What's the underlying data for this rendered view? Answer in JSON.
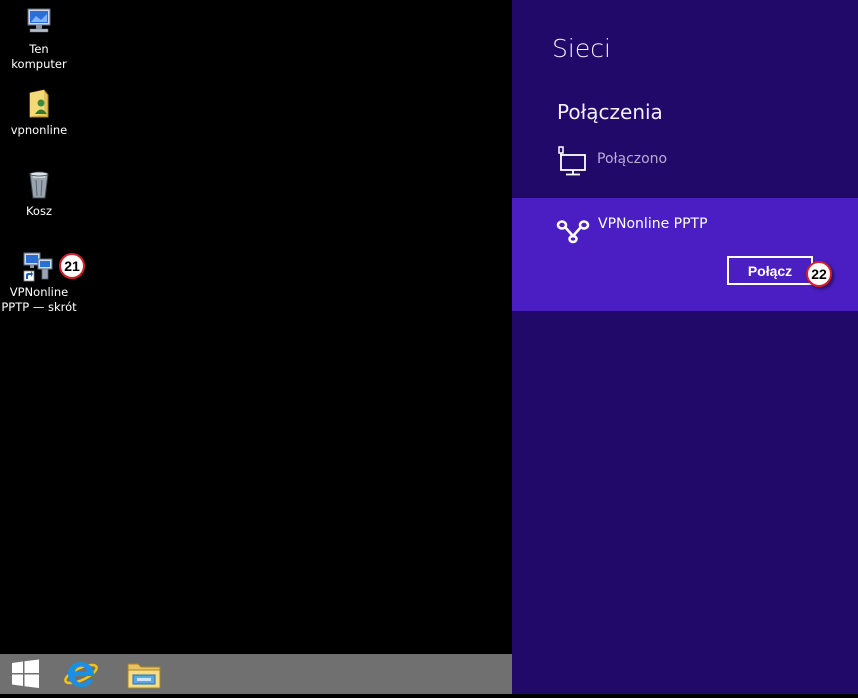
{
  "desktop": {
    "icons": [
      {
        "label": "Ten\nkomputer",
        "icon": "computer-icon"
      },
      {
        "label": "vpnonline",
        "icon": "user-folder-icon"
      },
      {
        "label": "Kosz",
        "icon": "recycle-bin-icon"
      },
      {
        "label": "VPNonline\nPPTP — skrót",
        "icon": "network-shortcut-icon"
      }
    ],
    "badge_21": "21"
  },
  "taskbar": {
    "items": [
      "windows-start-icon",
      "internet-explorer-icon",
      "file-explorer-icon"
    ]
  },
  "charm": {
    "title": "Sieci",
    "section_heading": "Połączenia",
    "lan_status": "Połączono",
    "vpn_name": "VPNonline PPTP",
    "connect_label": "Połącz",
    "badge_22": "22"
  },
  "colors": {
    "charm_bg": "#21096a",
    "selected_bg": "#4a1ec2",
    "badge_border": "#d4202a"
  }
}
